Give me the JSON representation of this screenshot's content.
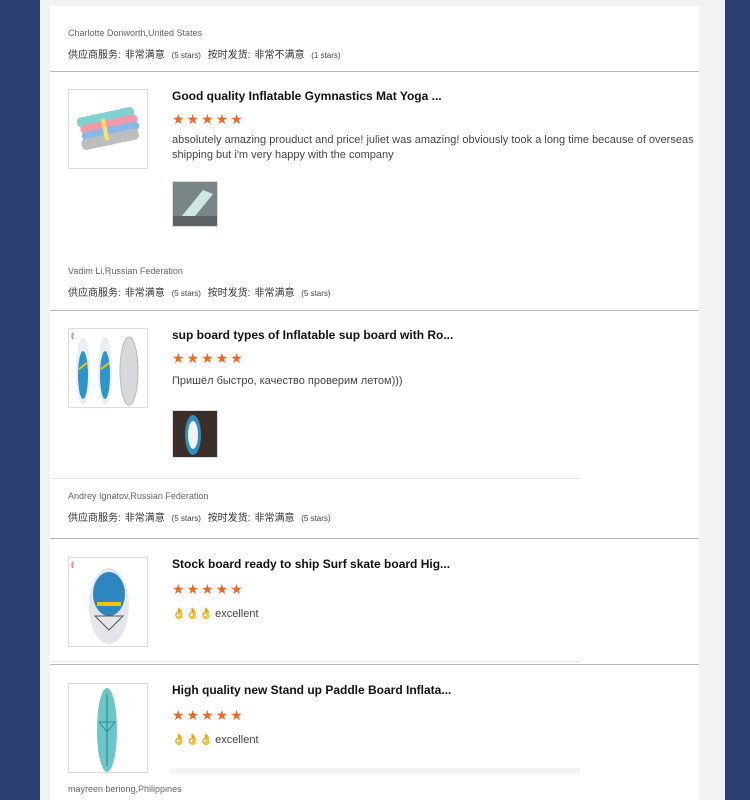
{
  "reviews": [
    {
      "reviewer": "Charlotte Donworth,United States",
      "supplier_label": "供应商服务:",
      "supplier_value": "非常满意",
      "supplier_stars": "(5 stars)",
      "delivery_label": "按时发货:",
      "delivery_value": "非常不满意",
      "delivery_stars": "(1 stars)"
    },
    {
      "reviewer": "Vadim Li,Russian Federation",
      "supplier_label": "供应商服务:",
      "supplier_value": "非常满意",
      "supplier_stars": "(5 stars)",
      "delivery_label": "按时发货:",
      "delivery_value": "非常满意",
      "delivery_stars": "(5 stars)"
    },
    {
      "reviewer": "Andrey Ignatov,Russian Federation",
      "supplier_label": "供应商服务:",
      "supplier_value": "非常满意",
      "supplier_stars": "(5 stars)",
      "delivery_label": "按时发货:",
      "delivery_value": "非常满意",
      "delivery_stars": "(5 stars)"
    },
    {
      "reviewer": "mayreen beriong,Philippines"
    }
  ],
  "products": [
    {
      "title": "Good quality Inflatable Gymnastics Mat Yoga ...",
      "rating": 5,
      "stars_text": "★★★★★",
      "comment": "absolutely amazing prouduct and price! juliet was amazing! obviously took a long time because of overseas shipping but i'm very happy with the company",
      "icon": "gymnastics-mat-image"
    },
    {
      "title": "sup board types of Inflatable sup board with Ro...",
      "rating": 5,
      "stars_text": "★★★★★",
      "comment": "Пришёл быстро, качество проверим летом)))",
      "icon": "sup-board-image"
    },
    {
      "title": "Stock board ready to ship Surf skate board Hig...",
      "rating": 5,
      "stars_text": "★★★★★",
      "comment": "excellent",
      "emoji": "👌👌👌",
      "icon": "surf-board-image"
    },
    {
      "title": "High quality new Stand up Paddle Board Inflata...",
      "rating": 5,
      "stars_text": "★★★★★",
      "comment": "excellent",
      "emoji": "👌👌👌",
      "icon": "paddle-board-image"
    }
  ],
  "colors": {
    "accent_star": "#f26522",
    "outer_background": "#2a3f72",
    "panel": "#ffffff"
  }
}
